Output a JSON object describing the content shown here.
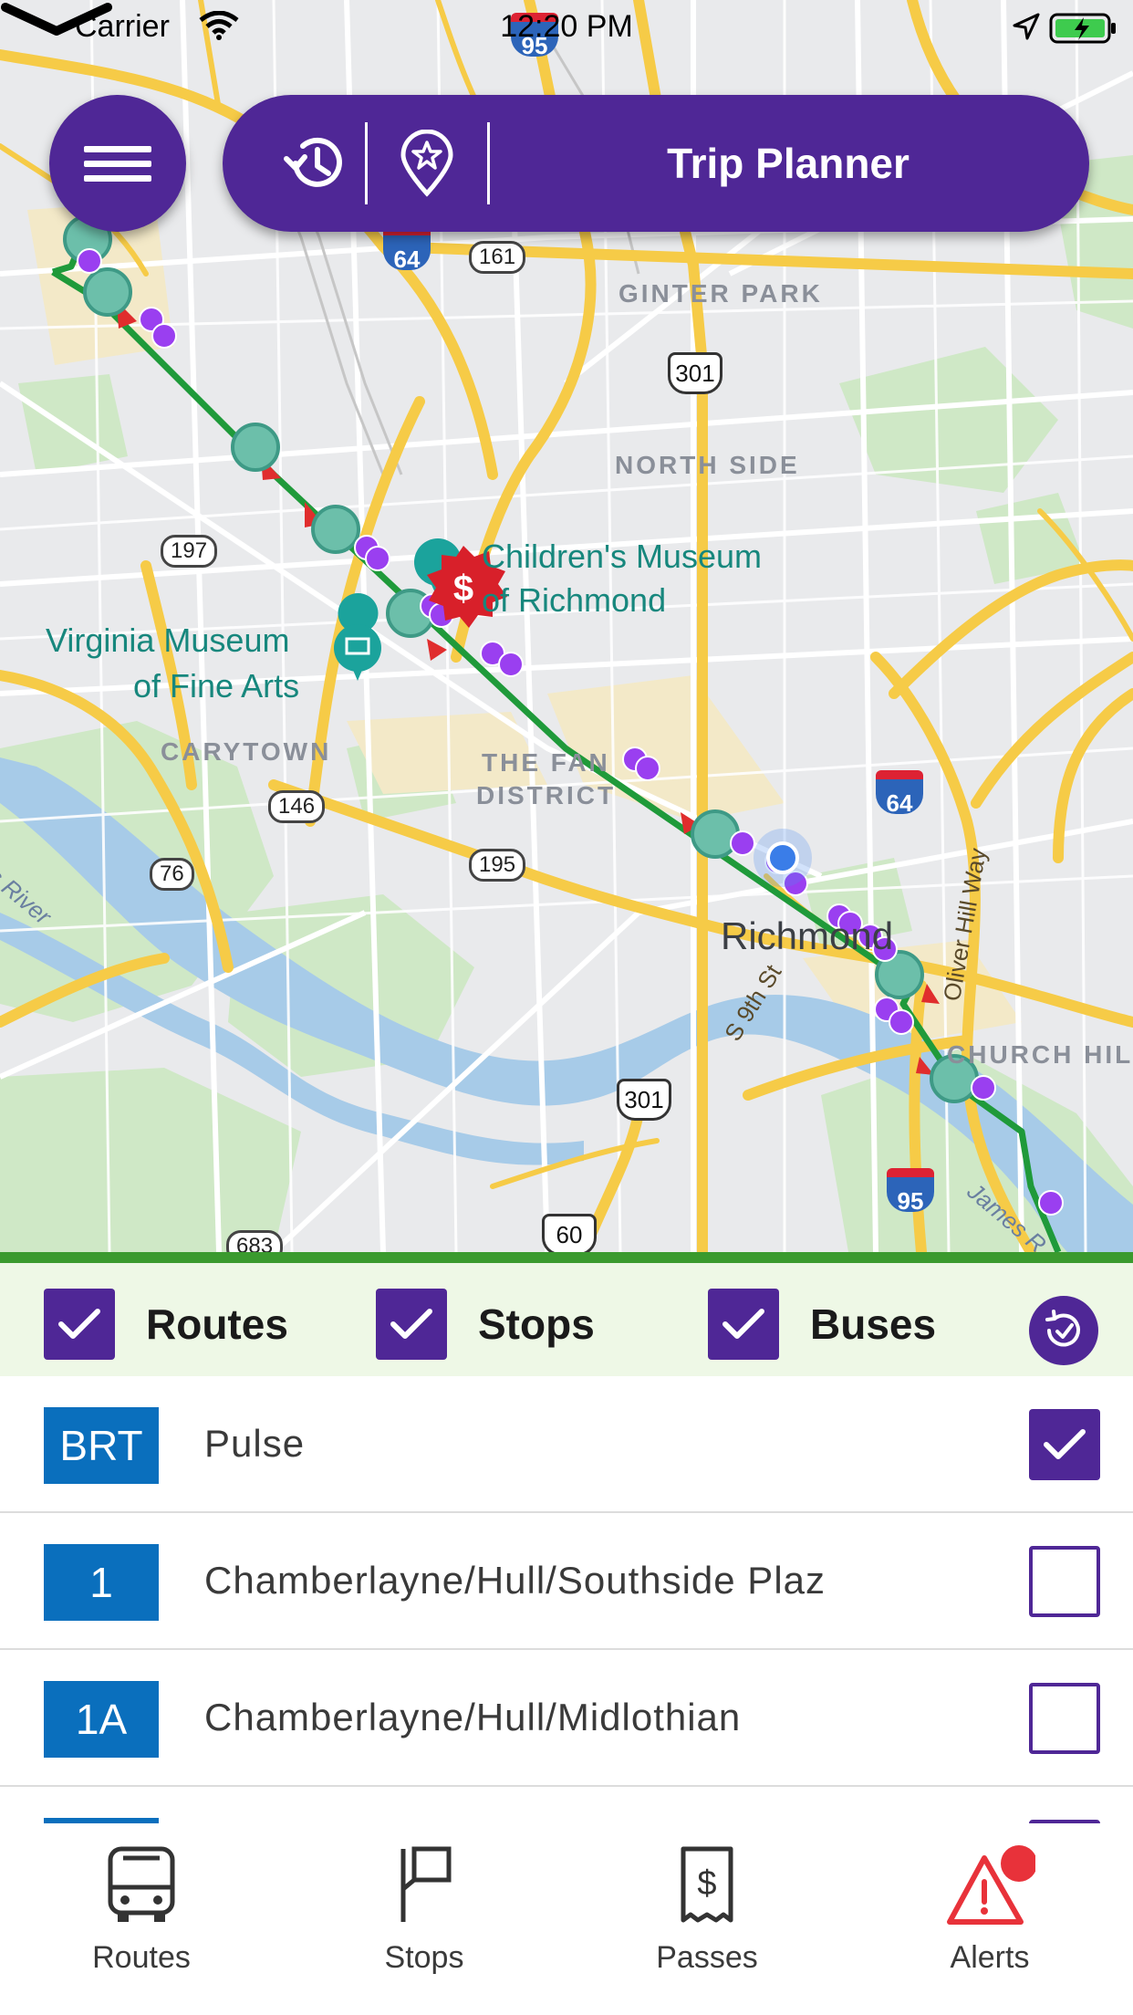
{
  "status_bar": {
    "carrier": "Carrier",
    "time": "12:20 PM"
  },
  "top_bar": {
    "trip_planner_label": "Trip Planner"
  },
  "map": {
    "districts": [
      "GINTER PARK",
      "NORTH SIDE",
      "CARYTOWN",
      "THE FAN",
      "DISTRICT",
      "CHURCH HIL"
    ],
    "pois": [
      "Children's Museum",
      "of Richmond",
      "Virginia Museum",
      "of Fine Arts"
    ],
    "city": "Richmond",
    "streets": [
      "S 9th St",
      "Oliver Hill Way"
    ],
    "rivers": [
      "James R",
      "s River"
    ],
    "highways": {
      "interstates": [
        "95",
        "64",
        "64",
        "95"
      ],
      "us_routes": [
        "301",
        "301",
        "60"
      ],
      "state_routes": [
        "161",
        "197",
        "146",
        "76",
        "195",
        "683"
      ]
    },
    "route_color": "#1f9a3a",
    "stop_color": "#6cbfaa",
    "bus_color": "#9a3ff0"
  },
  "filters": {
    "routes_label": "Routes",
    "stops_label": "Stops",
    "buses_label": "Buses",
    "routes_checked": true,
    "stops_checked": true,
    "buses_checked": true
  },
  "routes": [
    {
      "badge": "BRT",
      "name": "Pulse",
      "checked": true
    },
    {
      "badge": "1",
      "name": "Chamberlayne/Hull/Southside Plaz",
      "checked": false
    },
    {
      "badge": "1A",
      "name": "Chamberlayne/Hull/Midlothian",
      "checked": false
    }
  ],
  "tabs": [
    {
      "label": "Routes",
      "icon": "bus-icon"
    },
    {
      "label": "Stops",
      "icon": "stop-flag-icon"
    },
    {
      "label": "Passes",
      "icon": "ticket-icon"
    },
    {
      "label": "Alerts",
      "icon": "alert-icon"
    }
  ],
  "colors": {
    "primary": "#4f2796",
    "route_badge": "#0a6fbd",
    "alert": "#e8323a",
    "filter_bar_bg": "#eef8e6",
    "filter_bar_border": "#3a9a2e"
  }
}
